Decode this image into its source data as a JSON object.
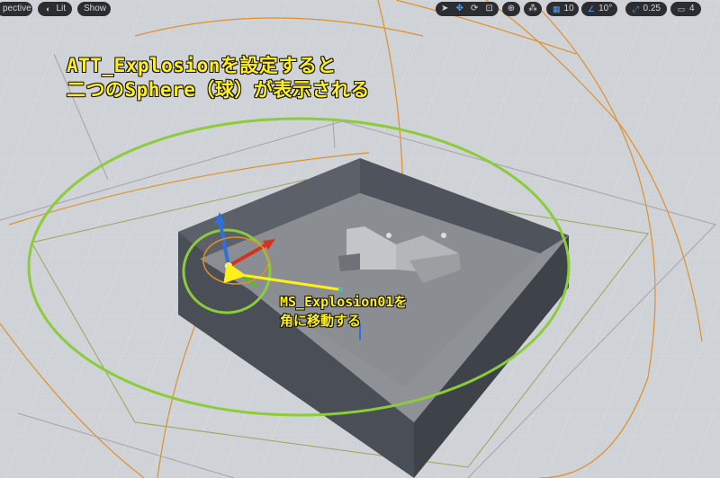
{
  "toolbar": {
    "perspective_label": "pective",
    "lit_label": "Lit",
    "show_label": "Show",
    "grid_snap_value": "10",
    "rotation_snap_value": "10°",
    "scale_snap_value": "0.25",
    "camera_speed_value": "4"
  },
  "annotations": {
    "callout_top_line1": "ATT_Explosionを設定すると",
    "callout_top_line2": "二つのSphere（球）が表示される",
    "callout_arrow_line1": "MS_Explosion01を",
    "callout_arrow_line2": "角に移動する"
  },
  "colors": {
    "viewport_bg": "#cfd2d6",
    "toolbar_bg": "#2b2d31",
    "accent_blue": "#4aa3ff",
    "annotation_yellow": "#ffef1a",
    "highlight_green": "#8ccc3a",
    "bounds_orange": "#e0902a",
    "room_wall": "#565b63",
    "room_floor": "#8e9196"
  },
  "icons": {
    "perspective": "hamburger-icon",
    "lit": "lit-mode-icon",
    "select": "select-cursor-icon",
    "translate": "move-arrows-icon",
    "rotate": "rotate-icon",
    "scale": "scale-icon",
    "world": "globe-icon",
    "surface_snap": "surface-snap-icon",
    "grid_snap": "grid-icon",
    "rotation_snap": "angle-icon",
    "scale_snap": "scale-arrow-icon",
    "camera_speed": "camera-icon"
  }
}
